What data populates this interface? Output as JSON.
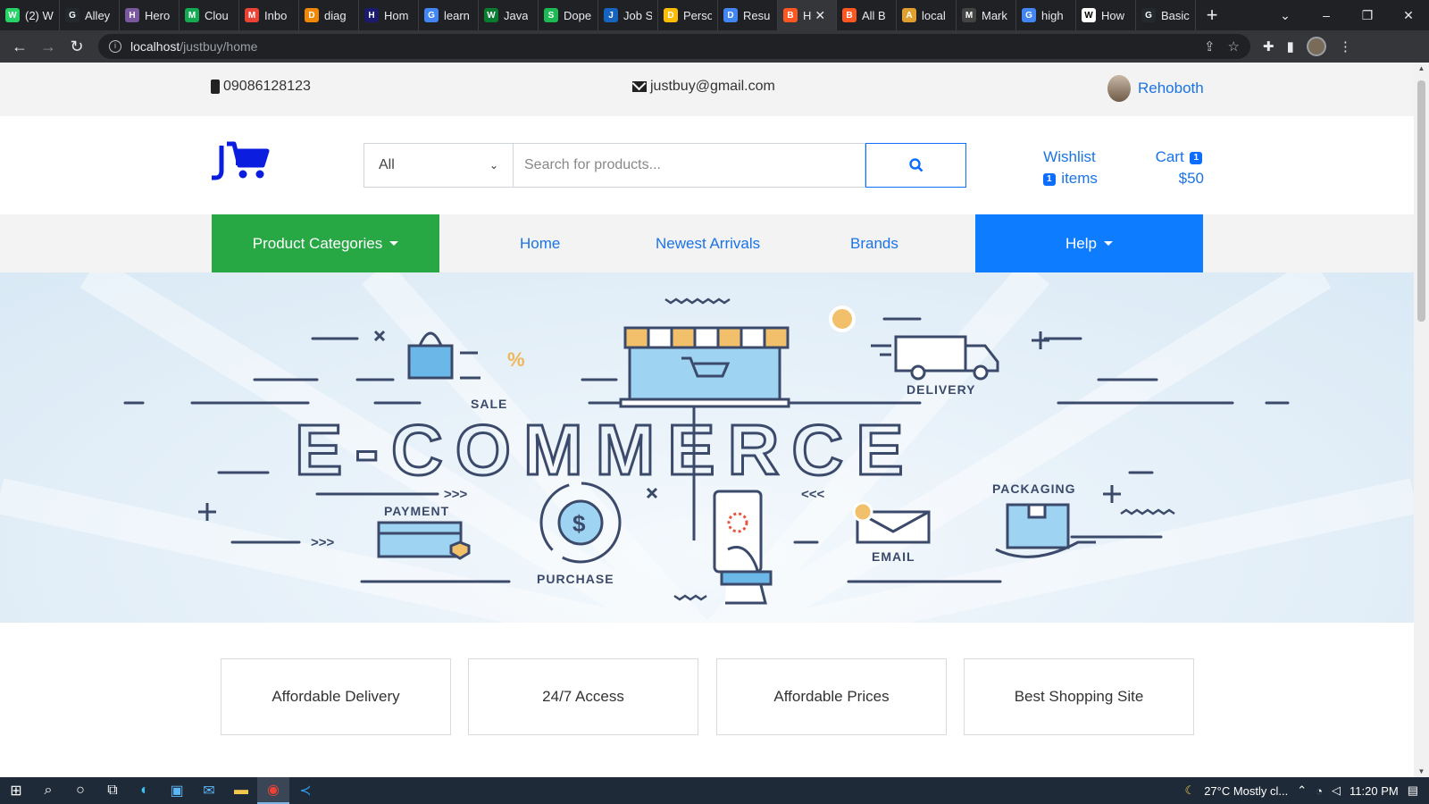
{
  "browser": {
    "tabs": [
      {
        "label": "(2) W",
        "color": "#25d366",
        "glyph": "W"
      },
      {
        "label": "Alley",
        "color": "#24292e",
        "glyph": "G"
      },
      {
        "label": "Hero",
        "color": "#79589f",
        "glyph": "H"
      },
      {
        "label": "Clou",
        "color": "#13aa52",
        "glyph": "M"
      },
      {
        "label": "Inbo",
        "color": "#ea4335",
        "glyph": "M"
      },
      {
        "label": "diag",
        "color": "#f08705",
        "glyph": "D"
      },
      {
        "label": "Hom",
        "color": "#1a1a6e",
        "glyph": "H"
      },
      {
        "label": "learn",
        "color": "#4285f4",
        "glyph": "G"
      },
      {
        "label": "Java",
        "color": "#0a7c2f",
        "glyph": "W"
      },
      {
        "label": "Dope",
        "color": "#1db954",
        "glyph": "S"
      },
      {
        "label": "Job S",
        "color": "#1565c0",
        "glyph": "J"
      },
      {
        "label": "Perso",
        "color": "#fbbc04",
        "glyph": "D"
      },
      {
        "label": "Resu",
        "color": "#4285f4",
        "glyph": "D"
      },
      {
        "label": "H",
        "color": "#ff5722",
        "glyph": "B",
        "active": true
      },
      {
        "label": "All B",
        "color": "#ff5722",
        "glyph": "B"
      },
      {
        "label": "local",
        "color": "#e0a030",
        "glyph": "A"
      },
      {
        "label": "Mark",
        "color": "#444444",
        "glyph": "M"
      },
      {
        "label": "high",
        "color": "#4285f4",
        "glyph": "G"
      },
      {
        "label": "How",
        "color": "#ffffff",
        "glyph": "W"
      },
      {
        "label": "Basic",
        "color": "#24292e",
        "glyph": "G"
      }
    ],
    "url_host": "localhost",
    "url_path": "/justbuy/home"
  },
  "topbar": {
    "phone": "09086128123",
    "email": "justbuy@gmail.com",
    "username": "Rehoboth"
  },
  "header": {
    "category_selected": "All",
    "search_placeholder": "Search for products...",
    "wishlist_label": "Wishlist",
    "wishlist_count": "1",
    "wishlist_items_label": "items",
    "cart_label": "Cart",
    "cart_count": "1",
    "cart_total": "$50"
  },
  "nav": {
    "categories": "Product Categories",
    "home": "Home",
    "newest": "Newest Arrivals",
    "brands": "Brands",
    "help": "Help"
  },
  "banner": {
    "title": "E-COMMERCE",
    "labels": {
      "sale": "SALE",
      "delivery": "DELIVERY",
      "payment": "PAYMENT",
      "purchase": "PURCHASE",
      "email": "EMAIL",
      "packaging": "PACKAGING"
    }
  },
  "features": [
    "Affordable Delivery",
    "24/7 Access",
    "Affordable Prices",
    "Best Shopping Site"
  ],
  "taskbar": {
    "weather": "27°C  Mostly cl...",
    "time": "11:20 PM"
  }
}
